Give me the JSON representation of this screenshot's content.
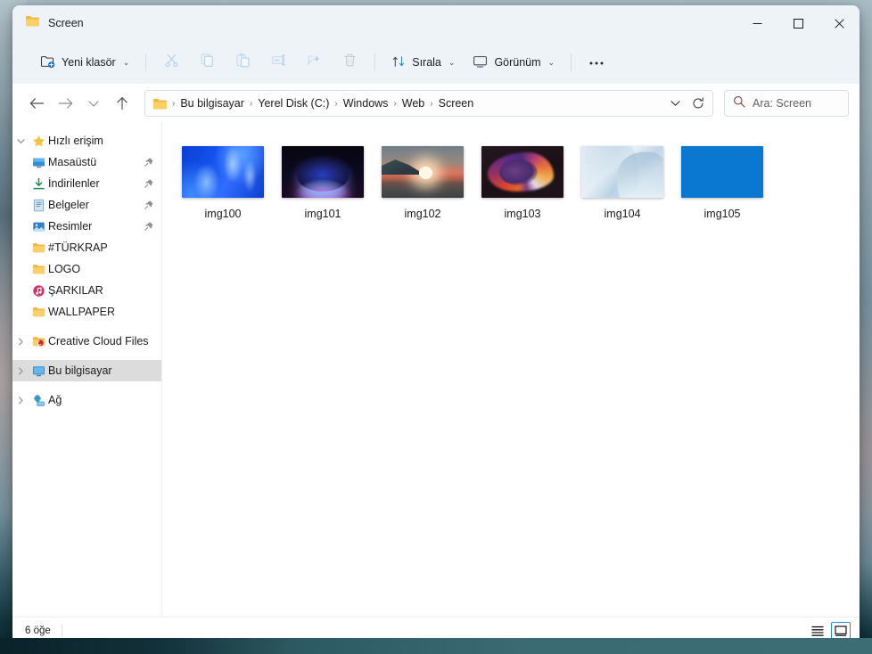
{
  "window": {
    "title": "Screen",
    "title_icon": "folder-icon",
    "controls": {
      "minimize": "minimize-icon",
      "maximize": "maximize-icon",
      "close": "close-icon"
    }
  },
  "toolbar": {
    "new_folder_label": "Yeni klasör",
    "new_folder_icon": "new-folder-icon",
    "new_folder_chevron": "chevron-down-icon",
    "actions": [
      {
        "name": "cut",
        "icon": "scissors-icon",
        "disabled": true
      },
      {
        "name": "copy",
        "icon": "copy-icon",
        "disabled": true
      },
      {
        "name": "paste",
        "icon": "paste-icon",
        "disabled": true
      },
      {
        "name": "rename",
        "icon": "rename-icon",
        "disabled": true
      },
      {
        "name": "share",
        "icon": "share-icon",
        "disabled": true
      },
      {
        "name": "delete",
        "icon": "trash-icon",
        "disabled": true
      }
    ],
    "sort_label": "Sırala",
    "sort_icon": "sort-arrows-icon",
    "view_label": "Görünüm",
    "view_icon": "monitor-icon",
    "more_label": "•••",
    "more_icon": "ellipsis-icon"
  },
  "addressbar": {
    "back_icon": "arrow-left-icon",
    "forward_icon": "arrow-right-icon",
    "recent_icon": "chevron-down-icon",
    "up_icon": "arrow-up-icon",
    "folder_icon": "folder-icon",
    "breadcrumbs": [
      "Bu bilgisayar",
      "Yerel Disk (C:)",
      "Windows",
      "Web",
      "Screen"
    ],
    "breadcrumb_separator": "›",
    "dropdown_icon": "chevron-down-icon",
    "refresh_icon": "refresh-icon",
    "search_icon": "search-icon",
    "search_placeholder": "Ara: Screen"
  },
  "sidebar": {
    "groups": [
      {
        "name": "quick-access",
        "label": "Hızlı erişim",
        "icon": "star-icon",
        "twisty": "chevron-down-icon",
        "expanded": true,
        "children": [
          {
            "label": "Masaüstü",
            "icon": "desktop-icon",
            "pinned": true
          },
          {
            "label": "İndirilenler",
            "icon": "downloads-icon",
            "pinned": true
          },
          {
            "label": "Belgeler",
            "icon": "documents-icon",
            "pinned": true
          },
          {
            "label": "Resimler",
            "icon": "pictures-icon",
            "pinned": true
          },
          {
            "label": "#TÜRKRAP",
            "icon": "folder-icon",
            "pinned": false
          },
          {
            "label": "LOGO",
            "icon": "folder-icon",
            "pinned": false
          },
          {
            "label": "ŞARKILAR",
            "icon": "music-icon",
            "pinned": false
          },
          {
            "label": "WALLPAPER",
            "icon": "folder-icon",
            "pinned": false
          }
        ]
      }
    ],
    "roots": [
      {
        "label": "Creative Cloud Files",
        "icon": "creative-cloud-icon",
        "twisty": "chevron-right-icon",
        "selected": false
      },
      {
        "label": "Bu bilgisayar",
        "icon": "this-pc-icon",
        "twisty": "chevron-right-icon",
        "selected": true
      },
      {
        "label": "Ağ",
        "icon": "network-icon",
        "twisty": "chevron-right-icon",
        "selected": false
      }
    ]
  },
  "content": {
    "items": [
      {
        "label": "img100",
        "thumb": "wp0"
      },
      {
        "label": "img101",
        "thumb": "wp1"
      },
      {
        "label": "img102",
        "thumb": "wp2"
      },
      {
        "label": "img103",
        "thumb": "wp3"
      },
      {
        "label": "img104",
        "thumb": "wp4"
      },
      {
        "label": "img105",
        "thumb": "wp5"
      }
    ]
  },
  "statusbar": {
    "item_count_text": "6 öğe",
    "view_list_icon": "list-view-icon",
    "view_tiles_icon": "large-icons-view-icon",
    "active_view": "large-icons-view-icon"
  },
  "colors": {
    "accent": "#2c8bd8",
    "chrome": "#eef3f7",
    "selection": "#dcdcdc",
    "folder_yellow": "#f7c249"
  }
}
